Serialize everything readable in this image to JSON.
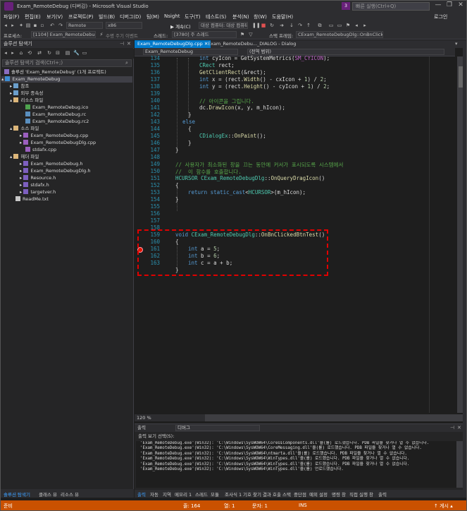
{
  "window": {
    "title": "Exam_RemoteDebug (디버깅) - Microsoft Visual Studio",
    "quick_launch_placeholder": "빠른 실행(Ctrl+Q)",
    "filter_badge": "3",
    "login": "로그인",
    "minimize": "—",
    "maximize": "❐",
    "close": "✕"
  },
  "menu": [
    "파일(F)",
    "편집(E)",
    "보기(V)",
    "프로젝트(P)",
    "빌드(B)",
    "디버그(D)",
    "팀(M)",
    "Nsight",
    "도구(T)",
    "테스트(S)",
    "분석(N)",
    "창(W)",
    "도움말(H)"
  ],
  "toolbar": {
    "config": "Remote",
    "platform": "x86",
    "continue_label": "▶ 계속(C)",
    "target": "대상 컴퓨터: 대상 컴퓨터 원격",
    "process_label": "프로세스:",
    "process_value": "[1104] Exam_RemoteDebug.exe",
    "lifecycle": "수명 주기 이벤트",
    "thread_label": "스레드:",
    "thread_value": "[3780] 주 스레드",
    "stack_label": "스택 프레임:",
    "stack_value": "CExam_RemoteDebugDlg::OnBnClickedB"
  },
  "solution_explorer": {
    "title": "솔루션 탐색기",
    "search_placeholder": "솔루션 탐색기 검색(Ctrl+;)",
    "items": [
      {
        "label": "솔루션 'Exam_RemoteDebug' (1개 프로젝트)",
        "icon": "sol"
      },
      {
        "label": "Exam_RemoteDebug",
        "icon": "proj"
      },
      {
        "label": "참조",
        "icon": "ref"
      },
      {
        "label": "외부 종속성",
        "icon": "ref"
      },
      {
        "label": "리소스 파일",
        "icon": "folder"
      },
      {
        "label": "Exam_RemoteDebug.ico",
        "icon": "ico"
      },
      {
        "label": "Exam_RemoteDebug.rc",
        "icon": "rc"
      },
      {
        "label": "Exam_RemoteDebug.rc2",
        "icon": "rc"
      },
      {
        "label": "소스 파일",
        "icon": "folder"
      },
      {
        "label": "Exam_RemoteDebug.cpp",
        "icon": "cpp"
      },
      {
        "label": "Exam_RemoteDebugDlg.cpp",
        "icon": "cpp"
      },
      {
        "label": "stdafx.cpp",
        "icon": "cpp"
      },
      {
        "label": "헤더 파일",
        "icon": "folder"
      },
      {
        "label": "Exam_RemoteDebug.h",
        "icon": "h"
      },
      {
        "label": "Exam_RemoteDebugDlg.h",
        "icon": "h"
      },
      {
        "label": "Resource.h",
        "icon": "h"
      },
      {
        "label": "stdafx.h",
        "icon": "h"
      },
      {
        "label": "targetver.h",
        "icon": "h"
      },
      {
        "label": "ReadMe.txt",
        "icon": "txt"
      }
    ],
    "bottom_tabs": [
      "솔루션 탐색기",
      "클래스 뷰",
      "리소스 뷰"
    ]
  },
  "editor": {
    "tabs": [
      "Exam_RemoteDebugDlg.cpp",
      "Exam_RemoteDebu..._DIALOG - Dialog"
    ],
    "nav_left": "Exam_RemoteDebug",
    "nav_right": "(전역 범위)",
    "zoom": "120 %",
    "line_numbers": [
      "134",
      "135",
      "136",
      "137",
      "138",
      "139",
      "140",
      "141",
      "142",
      "143",
      "144",
      "145",
      "146",
      "147",
      "148",
      "149",
      "150",
      "151",
      "152",
      "153",
      "154",
      "155",
      "156",
      "157",
      "158",
      "159",
      "160",
      "161",
      "162",
      "163"
    ]
  },
  "output": {
    "title": "출력",
    "source_label": "출력 보기 선택(S):",
    "source_value": "디버그",
    "lines": [
      "'Exam_RemoteDebug.exe'(Win32): 'C:\\Windows\\SysWOW64\\CoreUIComponents.dll'을(를) 로드했습니다. PDB 파일을 찾거나 열 수 없습니다.",
      "'Exam_RemoteDebug.exe'(Win32): 'C:\\Windows\\SysWOW64\\CoreMessaging.dll'을(를) 로드했습니다. PDB 파일을 찾거나 열 수 없습니다.",
      "'Exam_RemoteDebug.exe'(Win32): 'C:\\Windows\\SysWOW64\\ntmarta.dll'을(를) 로드했습니다. PDB 파일을 찾거나 열 수 없습니다.",
      "'Exam_RemoteDebug.exe'(Win32): 'C:\\Windows\\SysWOW64\\WinTypes.dll'을(를) 로드했습니다. PDB 파일을 찾거나 열 수 없습니다.",
      "'Exam_RemoteDebug.exe'(Win32): 'C:\\Windows\\SysWOW64\\WinTypes.dll'을(를) 로드했습니다. PDB 파일을 찾거나 열 수 없습니다.",
      "'Exam_RemoteDebug.exe'(Win32): 'C:\\Windows\\SysWOW64\\WinTypes.dll'을(를) 언로드했습니다."
    ],
    "tabs": [
      "출력",
      "자동",
      "지역",
      "메모리 1",
      "스레드",
      "모듈",
      "조사식 1",
      "기호 찾기 결과",
      "호출 스택",
      "중단점",
      "예외 설정",
      "명령 창",
      "직접 실행 창",
      "출력"
    ]
  },
  "status": {
    "ready": "준비",
    "line": "줄: 164",
    "col": "열: 1",
    "ch": "문자: 1",
    "ins": "INS",
    "publish": "↑ 게시 ▴"
  }
}
